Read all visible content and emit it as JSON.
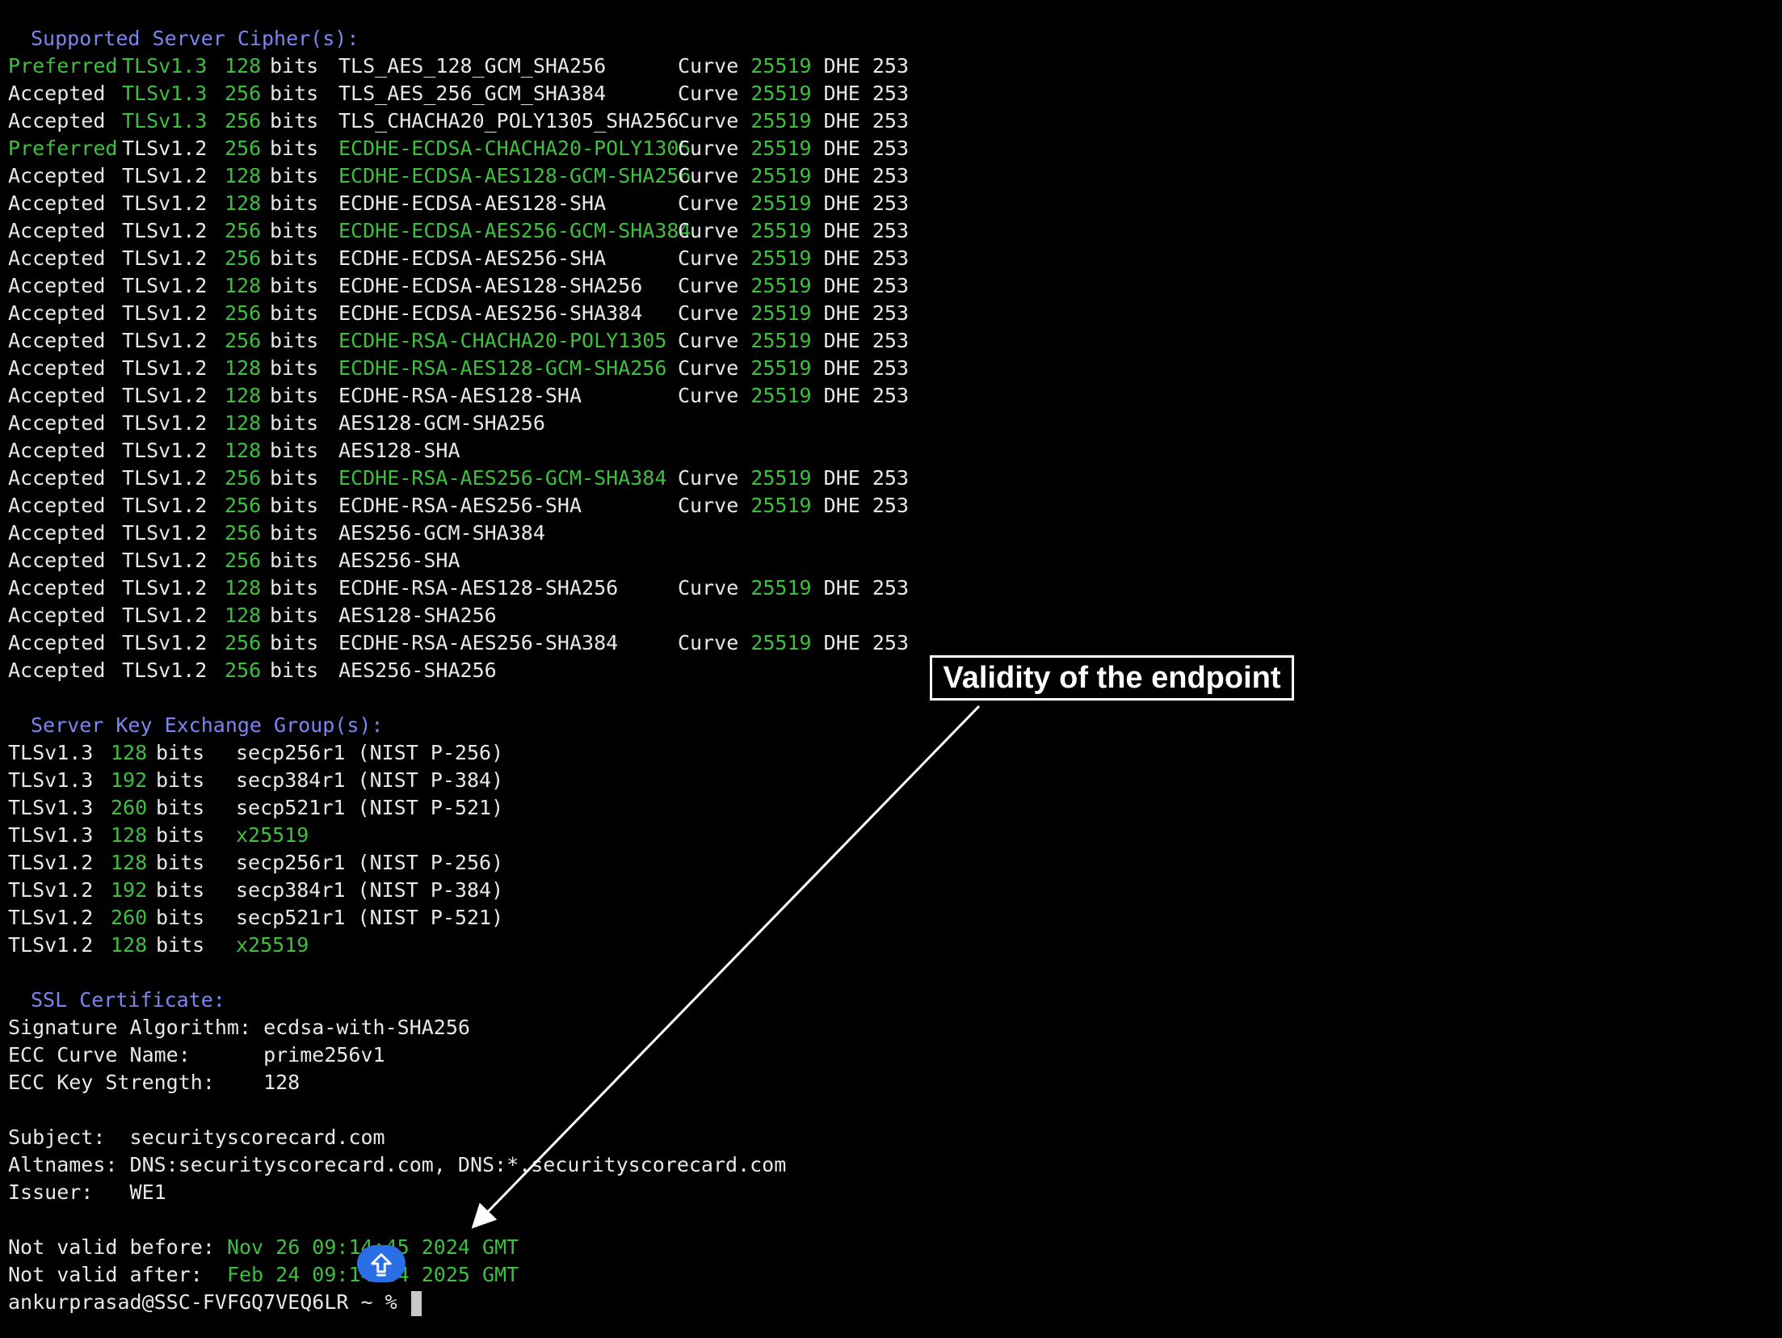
{
  "sections": {
    "ciphers_title": "Supported Server Cipher(s):",
    "kex_title": "Server Key Exchange Group(s):",
    "cert_title": "SSL Certificate:"
  },
  "ciphers": [
    {
      "status": "Preferred",
      "proto": "TLSv1.3",
      "bits": "128",
      "unit": "bits",
      "name": "TLS_AES_128_GCM_SHA256",
      "curve_label": "Curve",
      "curve": "25519",
      "dhe": "DHE 253",
      "status_green": true,
      "proto_green": true,
      "name_green": false
    },
    {
      "status": "Accepted",
      "proto": "TLSv1.3",
      "bits": "256",
      "unit": "bits",
      "name": "TLS_AES_256_GCM_SHA384",
      "curve_label": "Curve",
      "curve": "25519",
      "dhe": "DHE 253",
      "status_green": false,
      "proto_green": true,
      "name_green": false
    },
    {
      "status": "Accepted",
      "proto": "TLSv1.3",
      "bits": "256",
      "unit": "bits",
      "name": "TLS_CHACHA20_POLY1305_SHA256",
      "curve_label": "Curve",
      "curve": "25519",
      "dhe": "DHE 253",
      "status_green": false,
      "proto_green": true,
      "name_green": false
    },
    {
      "status": "Preferred",
      "proto": "TLSv1.2",
      "bits": "256",
      "unit": "bits",
      "name": "ECDHE-ECDSA-CHACHA20-POLY1305",
      "curve_label": "Curve",
      "curve": "25519",
      "dhe": "DHE 253",
      "status_green": true,
      "proto_green": false,
      "name_green": true
    },
    {
      "status": "Accepted",
      "proto": "TLSv1.2",
      "bits": "128",
      "unit": "bits",
      "name": "ECDHE-ECDSA-AES128-GCM-SHA256",
      "curve_label": "Curve",
      "curve": "25519",
      "dhe": "DHE 253",
      "status_green": false,
      "proto_green": false,
      "name_green": true
    },
    {
      "status": "Accepted",
      "proto": "TLSv1.2",
      "bits": "128",
      "unit": "bits",
      "name": "ECDHE-ECDSA-AES128-SHA",
      "curve_label": "Curve",
      "curve": "25519",
      "dhe": "DHE 253",
      "status_green": false,
      "proto_green": false,
      "name_green": false
    },
    {
      "status": "Accepted",
      "proto": "TLSv1.2",
      "bits": "256",
      "unit": "bits",
      "name": "ECDHE-ECDSA-AES256-GCM-SHA384",
      "curve_label": "Curve",
      "curve": "25519",
      "dhe": "DHE 253",
      "status_green": false,
      "proto_green": false,
      "name_green": true
    },
    {
      "status": "Accepted",
      "proto": "TLSv1.2",
      "bits": "256",
      "unit": "bits",
      "name": "ECDHE-ECDSA-AES256-SHA",
      "curve_label": "Curve",
      "curve": "25519",
      "dhe": "DHE 253",
      "status_green": false,
      "proto_green": false,
      "name_green": false
    },
    {
      "status": "Accepted",
      "proto": "TLSv1.2",
      "bits": "128",
      "unit": "bits",
      "name": "ECDHE-ECDSA-AES128-SHA256",
      "curve_label": "Curve",
      "curve": "25519",
      "dhe": "DHE 253",
      "status_green": false,
      "proto_green": false,
      "name_green": false
    },
    {
      "status": "Accepted",
      "proto": "TLSv1.2",
      "bits": "256",
      "unit": "bits",
      "name": "ECDHE-ECDSA-AES256-SHA384",
      "curve_label": "Curve",
      "curve": "25519",
      "dhe": "DHE 253",
      "status_green": false,
      "proto_green": false,
      "name_green": false
    },
    {
      "status": "Accepted",
      "proto": "TLSv1.2",
      "bits": "256",
      "unit": "bits",
      "name": "ECDHE-RSA-CHACHA20-POLY1305",
      "curve_label": "Curve",
      "curve": "25519",
      "dhe": "DHE 253",
      "status_green": false,
      "proto_green": false,
      "name_green": true
    },
    {
      "status": "Accepted",
      "proto": "TLSv1.2",
      "bits": "128",
      "unit": "bits",
      "name": "ECDHE-RSA-AES128-GCM-SHA256",
      "curve_label": "Curve",
      "curve": "25519",
      "dhe": "DHE 253",
      "status_green": false,
      "proto_green": false,
      "name_green": true
    },
    {
      "status": "Accepted",
      "proto": "TLSv1.2",
      "bits": "128",
      "unit": "bits",
      "name": "ECDHE-RSA-AES128-SHA",
      "curve_label": "Curve",
      "curve": "25519",
      "dhe": "DHE 253",
      "status_green": false,
      "proto_green": false,
      "name_green": false
    },
    {
      "status": "Accepted",
      "proto": "TLSv1.2",
      "bits": "128",
      "unit": "bits",
      "name": "AES128-GCM-SHA256",
      "curve_label": "",
      "curve": "",
      "dhe": "",
      "status_green": false,
      "proto_green": false,
      "name_green": false
    },
    {
      "status": "Accepted",
      "proto": "TLSv1.2",
      "bits": "128",
      "unit": "bits",
      "name": "AES128-SHA",
      "curve_label": "",
      "curve": "",
      "dhe": "",
      "status_green": false,
      "proto_green": false,
      "name_green": false
    },
    {
      "status": "Accepted",
      "proto": "TLSv1.2",
      "bits": "256",
      "unit": "bits",
      "name": "ECDHE-RSA-AES256-GCM-SHA384",
      "curve_label": "Curve",
      "curve": "25519",
      "dhe": "DHE 253",
      "status_green": false,
      "proto_green": false,
      "name_green": true
    },
    {
      "status": "Accepted",
      "proto": "TLSv1.2",
      "bits": "256",
      "unit": "bits",
      "name": "ECDHE-RSA-AES256-SHA",
      "curve_label": "Curve",
      "curve": "25519",
      "dhe": "DHE 253",
      "status_green": false,
      "proto_green": false,
      "name_green": false
    },
    {
      "status": "Accepted",
      "proto": "TLSv1.2",
      "bits": "256",
      "unit": "bits",
      "name": "AES256-GCM-SHA384",
      "curve_label": "",
      "curve": "",
      "dhe": "",
      "status_green": false,
      "proto_green": false,
      "name_green": false
    },
    {
      "status": "Accepted",
      "proto": "TLSv1.2",
      "bits": "256",
      "unit": "bits",
      "name": "AES256-SHA",
      "curve_label": "",
      "curve": "",
      "dhe": "",
      "status_green": false,
      "proto_green": false,
      "name_green": false
    },
    {
      "status": "Accepted",
      "proto": "TLSv1.2",
      "bits": "128",
      "unit": "bits",
      "name": "ECDHE-RSA-AES128-SHA256",
      "curve_label": "Curve",
      "curve": "25519",
      "dhe": "DHE 253",
      "status_green": false,
      "proto_green": false,
      "name_green": false
    },
    {
      "status": "Accepted",
      "proto": "TLSv1.2",
      "bits": "128",
      "unit": "bits",
      "name": "AES128-SHA256",
      "curve_label": "",
      "curve": "",
      "dhe": "",
      "status_green": false,
      "proto_green": false,
      "name_green": false
    },
    {
      "status": "Accepted",
      "proto": "TLSv1.2",
      "bits": "256",
      "unit": "bits",
      "name": "ECDHE-RSA-AES256-SHA384",
      "curve_label": "Curve",
      "curve": "25519",
      "dhe": "DHE 253",
      "status_green": false,
      "proto_green": false,
      "name_green": false
    },
    {
      "status": "Accepted",
      "proto": "TLSv1.2",
      "bits": "256",
      "unit": "bits",
      "name": "AES256-SHA256",
      "curve_label": "",
      "curve": "",
      "dhe": "",
      "status_green": false,
      "proto_green": false,
      "name_green": false
    }
  ],
  "kex_groups": [
    {
      "proto": "TLSv1.3",
      "bits": "128",
      "unit": "bits",
      "name": "secp256r1 (NIST P-256)",
      "name_green": false
    },
    {
      "proto": "TLSv1.3",
      "bits": "192",
      "unit": "bits",
      "name": "secp384r1 (NIST P-384)",
      "name_green": false
    },
    {
      "proto": "TLSv1.3",
      "bits": "260",
      "unit": "bits",
      "name": "secp521r1 (NIST P-521)",
      "name_green": false
    },
    {
      "proto": "TLSv1.3",
      "bits": "128",
      "unit": "bits",
      "name": "x25519",
      "name_green": true
    },
    {
      "proto": "TLSv1.2",
      "bits": "128",
      "unit": "bits",
      "name": "secp256r1 (NIST P-256)",
      "name_green": false
    },
    {
      "proto": "TLSv1.2",
      "bits": "192",
      "unit": "bits",
      "name": "secp384r1 (NIST P-384)",
      "name_green": false
    },
    {
      "proto": "TLSv1.2",
      "bits": "260",
      "unit": "bits",
      "name": "secp521r1 (NIST P-521)",
      "name_green": false
    },
    {
      "proto": "TLSv1.2",
      "bits": "128",
      "unit": "bits",
      "name": "x25519",
      "name_green": true
    }
  ],
  "cert": {
    "sig_alg_label": "Signature Algorithm: ",
    "sig_alg": "ecdsa-with-SHA256",
    "curve_name_label": "ECC Curve Name:      ",
    "curve_name": "prime256v1",
    "key_strength_label": "ECC Key Strength:    ",
    "key_strength": "128",
    "subject_label": "Subject:  ",
    "subject": "securityscorecard.com",
    "altnames_label": "Altnames: ",
    "altnames": "DNS:securityscorecard.com, DNS:*.securityscorecard.com",
    "issuer_label": "Issuer:   ",
    "issuer": "WE1",
    "not_before_label": "Not valid before: ",
    "not_before": "Nov 26 09:14:45 2024 GMT",
    "not_after_label": "Not valid after:  ",
    "not_after": "Feb 24 09:14:44 2025 GMT"
  },
  "prompt": "ankurprasad@SSC-FVFGQ7VEQ6LR ~ % ",
  "annotation": "Validity of the endpoint",
  "colors": {
    "background": "#000000",
    "text": "#e8e8e8",
    "green": "#3fbf3f",
    "heading": "#7b86f0",
    "scroll_button": "#2b6fe6"
  },
  "icons": {
    "scroll_button": "arrow-up-icon"
  }
}
